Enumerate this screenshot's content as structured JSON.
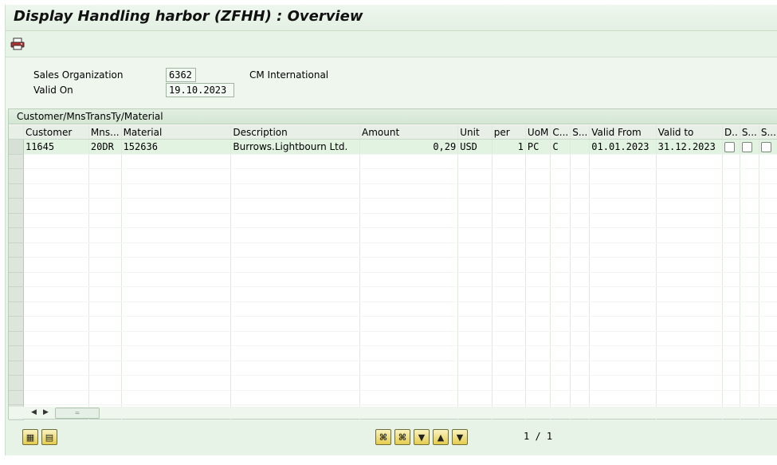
{
  "window": {
    "title": "Display Handling harbor (ZFHH) : Overview"
  },
  "toolbar": {
    "print_icon": "printer-icon"
  },
  "header": {
    "sales_org_label": "Sales Organization",
    "sales_org_value": "6362",
    "sales_org_name": "CM International",
    "valid_on_label": "Valid On",
    "valid_on_value": "19.10.2023"
  },
  "table": {
    "title": "Customer/MnsTransTy/Material",
    "columns": {
      "customer": "Customer",
      "mns": "Mns...",
      "material": "Material",
      "description": "Description",
      "amount": "Amount",
      "unit": "Unit",
      "per": "per",
      "uom": "UoM",
      "c": "C...",
      "s": "S...",
      "valid_from": "Valid From",
      "valid_to": "Valid to",
      "d": "D..",
      "s2": "S...",
      "s3": "S..."
    },
    "rows": [
      {
        "customer": "11645",
        "mns": "20DR",
        "material": "152636",
        "description": "Burrows.Lightbourn Ltd.",
        "amount": "0,29",
        "unit": "USD",
        "per": "1",
        "uom": "PC",
        "c": "C",
        "s": "",
        "valid_from": "01.01.2023",
        "valid_to": "31.12.2023",
        "d": false,
        "s2": false,
        "s3": false
      }
    ]
  },
  "footer": {
    "page_info": "1 / 1"
  },
  "colors": {
    "background": "#e8f3e8",
    "selected_row": "#e2f3e2",
    "button_yellow": "#e5cc4c"
  }
}
